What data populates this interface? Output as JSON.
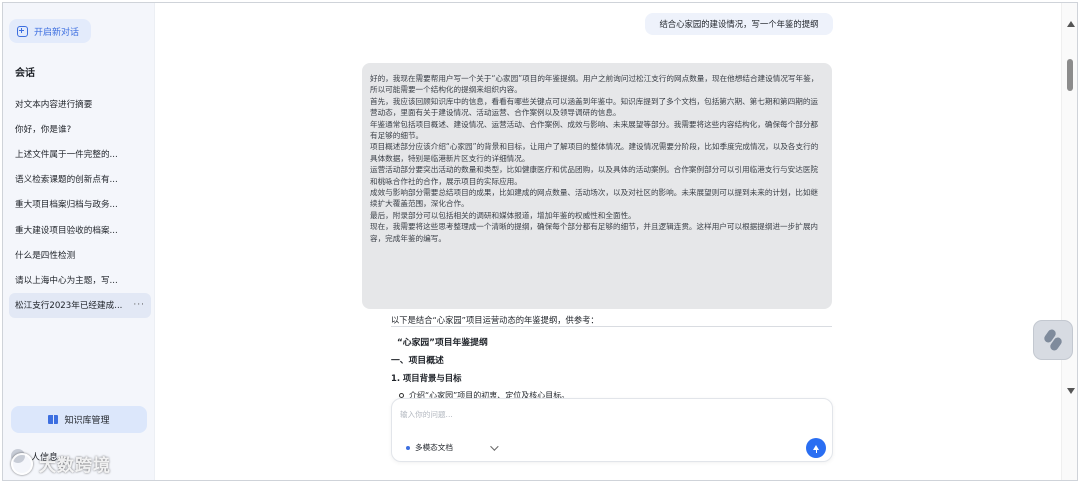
{
  "sidebar": {
    "new_chat_label": "开启新对话",
    "section_title": "会话",
    "items": [
      {
        "label": "对文本内容进行摘要"
      },
      {
        "label": "你好，你是谁?"
      },
      {
        "label": "上述文件属于一件完整的..."
      },
      {
        "label": "语义检索课题的创新点有..."
      },
      {
        "label": "重大项目档案归档与政务..."
      },
      {
        "label": "重大建设项目验收的档案..."
      },
      {
        "label": "什么是四性检测"
      },
      {
        "label": "请以上海中心为主题，写..."
      },
      {
        "label": "松江支行2023年已经建成..."
      }
    ],
    "active_more": "···",
    "knowledge_base_label": "知识库管理",
    "user_label": "人信息"
  },
  "chat": {
    "user_message": "结合心家园的建设情况，写一个年鉴的提纲",
    "thinking": [
      "好的，我现在需要帮用户写一个关于“心家园”项目的年鉴提纲。用户之前询问过松江支行的网点数量，现在他想结合建设情况写年鉴，所以可能需要一个结构化的提纲来组织内容。",
      "首先，我应该回顾知识库中的信息，看看有哪些关键点可以涵盖到年鉴中。知识库提到了多个文档，包括第六期、第七期和第四期的运营动态，里面有关于建设情况、活动运营、合作案例以及领导调研的信息。",
      "年鉴通常包括项目概述、建设情况、运营活动、合作案例、成效与影响、未来展望等部分。我需要将这些内容结构化，确保每个部分都有足够的细节。",
      "项目概述部分应该介绍“心家园”的背景和目标，让用户了解项目的整体情况。建设情况需要分阶段，比如季度完成情况，以及各支行的具体数据，特别是临港新片区支行的详细情况。",
      "运营活动部分要突出活动的数量和类型，比如健康医疗和优品团购，以及具体的活动案例。合作案例部分可以引用临港支行与安达医院和桃咏合作社的合作，展示项目的实际应用。",
      "成效与影响部分需要总结项目的成果，比如建成的网点数量、活动场次，以及对社区的影响。未来展望则可以提到未来的计划，比如继续扩大覆盖范围，深化合作。",
      "最后，附录部分可以包括相关的调研和媒体报道，增加年鉴的权威性和全面性。",
      "现在，我需要将这些思考整理成一个清晰的提纲，确保每个部分都有足够的细节，并且逻辑连贯。这样用户可以根据提纲进一步扩展内容，完成年鉴的编写。"
    ],
    "answer_intro": "以下是结合“心家园”项目运营动态的年鉴提纲，供参考：",
    "answer_title": "“心家园”项目年鉴提纲",
    "section_1": "一、项目概述",
    "section_1_1": "1. 项目背景与目标",
    "bullet_1": "介绍“心家园”项目的初衷、定位及核心目标。"
  },
  "input": {
    "placeholder": "输入你的问题...",
    "mode_label": "多模态文档"
  },
  "watermark": "大数跨境",
  "colors": {
    "accent": "#3d6fe0",
    "send_button": "#2a6ef2",
    "sidebar_bg": "#f4f6fb",
    "thinking_bg": "#e6e7e9"
  }
}
